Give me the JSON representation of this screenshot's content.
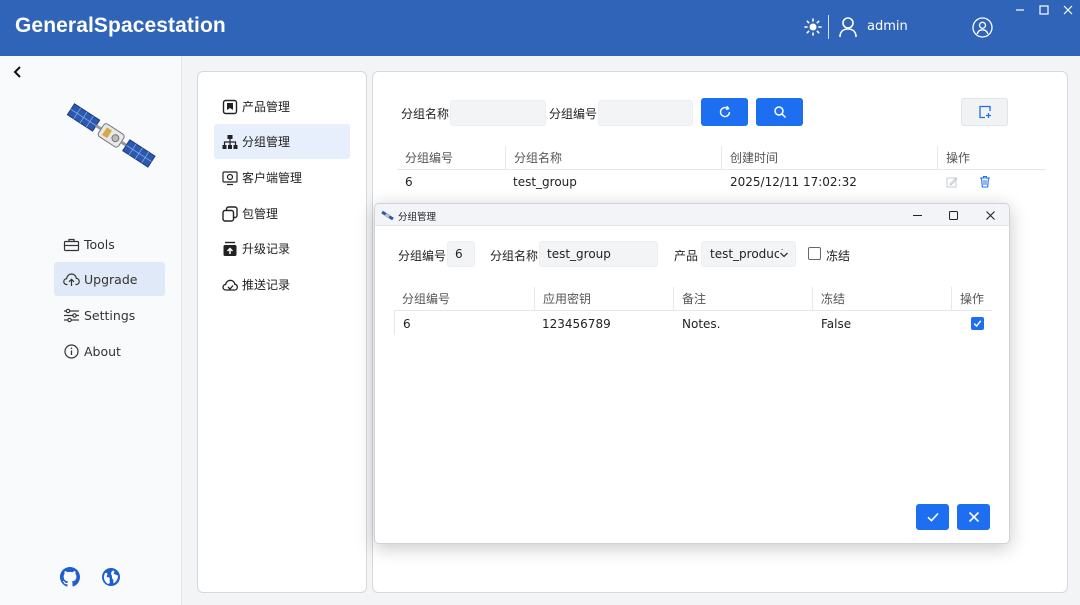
{
  "app": {
    "title": "GeneralSpacestation",
    "user": "admin"
  },
  "sidebar": {
    "items": [
      {
        "label": "Tools",
        "icon": "toolbox-icon"
      },
      {
        "label": "Upgrade",
        "icon": "cloud-upload-icon",
        "active": true
      },
      {
        "label": "Settings",
        "icon": "sliders-icon"
      },
      {
        "label": "About",
        "icon": "info-icon"
      }
    ],
    "footer_icons": [
      "github-icon",
      "globe-icon"
    ]
  },
  "submenu": {
    "items": [
      {
        "label": "产品管理",
        "icon": "product-box-icon"
      },
      {
        "label": "分组管理",
        "icon": "group-tree-icon",
        "active": true
      },
      {
        "label": "客户端管理",
        "icon": "client-icon"
      },
      {
        "label": "包管理",
        "icon": "package-icon"
      },
      {
        "label": "升级记录",
        "icon": "upgrade-record-icon"
      },
      {
        "label": "推送记录",
        "icon": "push-cloud-icon"
      }
    ]
  },
  "search": {
    "group_name_label": "分组名称",
    "group_name_value": "",
    "group_id_label": "分组编号",
    "group_id_value": ""
  },
  "table": {
    "headers": [
      "分组编号",
      "分组名称",
      "创建时间",
      "操作"
    ],
    "rows": [
      {
        "id": "6",
        "name": "test_group",
        "created": "2025/12/11 17:02:32"
      }
    ]
  },
  "dialog": {
    "title": "分组管理",
    "group_id_label": "分组编号",
    "group_id_value": "6",
    "group_name_label": "分组名称",
    "group_name_value": "test_group",
    "product_label": "产品",
    "product_value": "test_product",
    "freeze_label": "冻结",
    "freeze_checked": false,
    "table": {
      "headers": [
        "分组编号",
        "应用密钥",
        "备注",
        "冻结",
        "操作"
      ],
      "rows": [
        {
          "id": "6",
          "key": "123456789",
          "note": "Notes.",
          "frozen": "False",
          "selected": true
        }
      ]
    }
  },
  "colors": {
    "header": "#2f64b8",
    "primary": "#1d6ef0",
    "active_nav": "#dfe9f7"
  }
}
